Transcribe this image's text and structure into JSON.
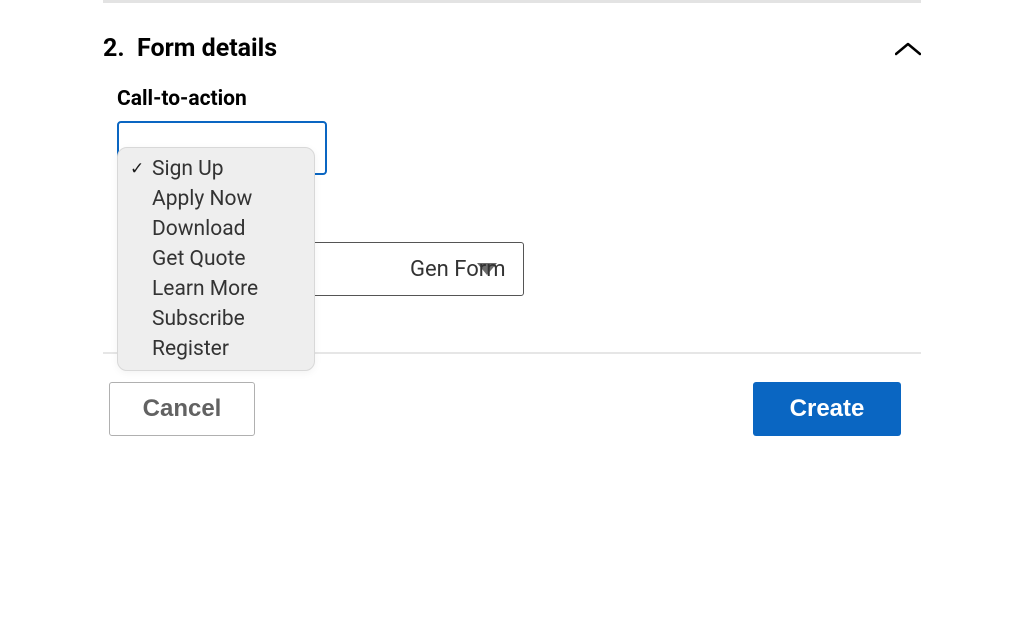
{
  "section": {
    "number": "2.",
    "title": "Form details"
  },
  "cta": {
    "label": "Call-to-action",
    "options": [
      {
        "label": "Sign Up",
        "selected": true
      },
      {
        "label": "Apply Now",
        "selected": false
      },
      {
        "label": "Download",
        "selected": false
      },
      {
        "label": "Get Quote",
        "selected": false
      },
      {
        "label": "Learn More",
        "selected": false
      },
      {
        "label": "Subscribe",
        "selected": false
      },
      {
        "label": "Register",
        "selected": false
      }
    ]
  },
  "form_select": {
    "visible_label": "Gen Form"
  },
  "footer": {
    "cancel": "Cancel",
    "create": "Create"
  }
}
